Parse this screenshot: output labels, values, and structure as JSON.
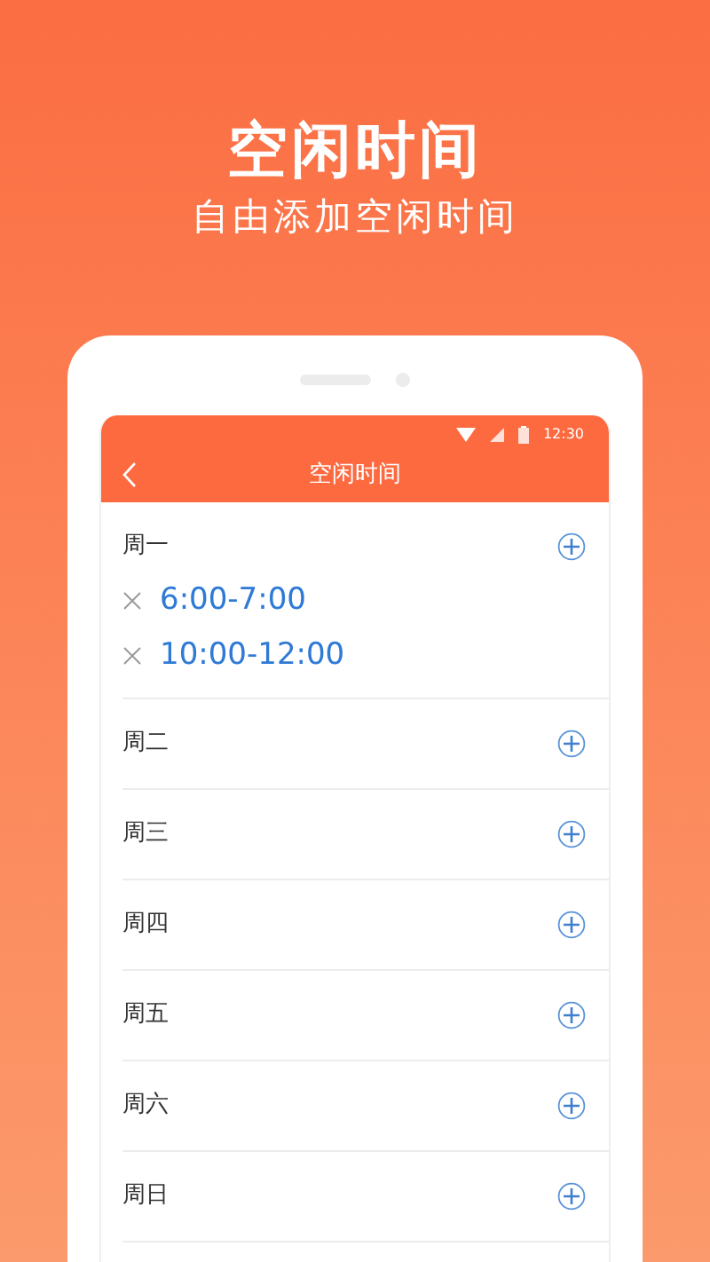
{
  "promo": {
    "title": "空闲时间",
    "subtitle": "自由添加空闲时间"
  },
  "status_bar": {
    "time": "12:30"
  },
  "header": {
    "title": "空闲时间"
  },
  "days": [
    {
      "label": "周一",
      "slots": [
        "6:00-7:00",
        "10:00-12:00"
      ]
    },
    {
      "label": "周二"
    },
    {
      "label": "周三"
    },
    {
      "label": "周四"
    },
    {
      "label": "周五"
    },
    {
      "label": "周六"
    },
    {
      "label": "周日"
    }
  ]
}
